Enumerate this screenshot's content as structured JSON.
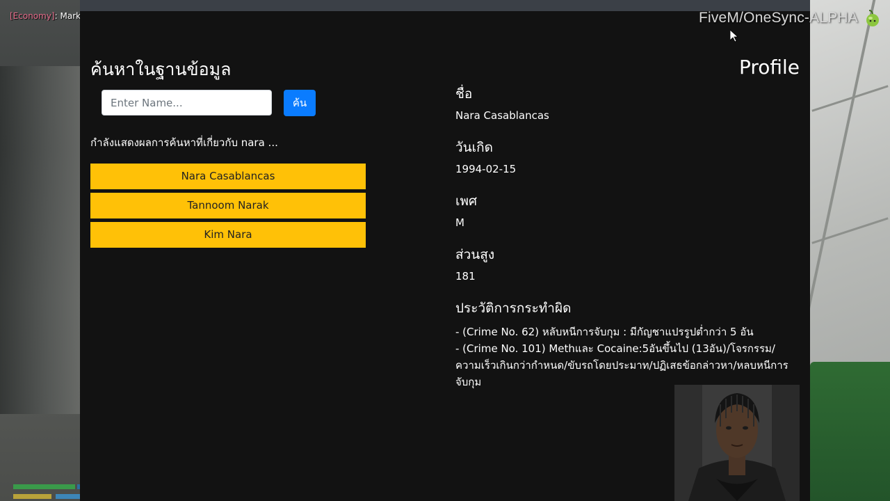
{
  "chat": {
    "tag": "[Economy]",
    "message": ": Market"
  },
  "watermark": {
    "text": "FiveM/OneSync-ALPHA",
    "icon": "pepper-icon"
  },
  "search": {
    "title": "ค้นหาในฐานข้อมูล",
    "placeholder": "Enter Name...",
    "button_label": "ค้น",
    "result_caption": "กำลังแสดงผลการค้นหาที่เกี่ยวกับ nara ...",
    "results": [
      "Nara Casablancas",
      "Tannoom Narak",
      "Kim Nara"
    ]
  },
  "profile": {
    "title": "Profile",
    "name_label": "ชื่อ",
    "name": "Nara Casablancas",
    "dob_label": "วันเกิด",
    "dob": "1994-02-15",
    "sex_label": "เพศ",
    "sex": "M",
    "height_label": "ส่วนสูง",
    "height": "181",
    "crimes_label": "ประวัติการกระทำผิด",
    "crimes": [
      "- (Crime No. 62) หลับหนีการจับกุม : มีกัญชาแปรรูปต่ำกว่า 5 อัน",
      "- (Crime No. 101) Methและ Cocaine:5อันขึ้นไป (13อัน)/โจรกรรม/ความเร็วเกินกว่ากำหนด/ขับรถโดยประมาท/ปฏิเสธข้อกล่าวหา/หลบหนีการจับกุม"
    ]
  },
  "colors": {
    "panel_bg": "#121212",
    "result_button": "#ffc107",
    "search_button": "#0a7cff"
  }
}
